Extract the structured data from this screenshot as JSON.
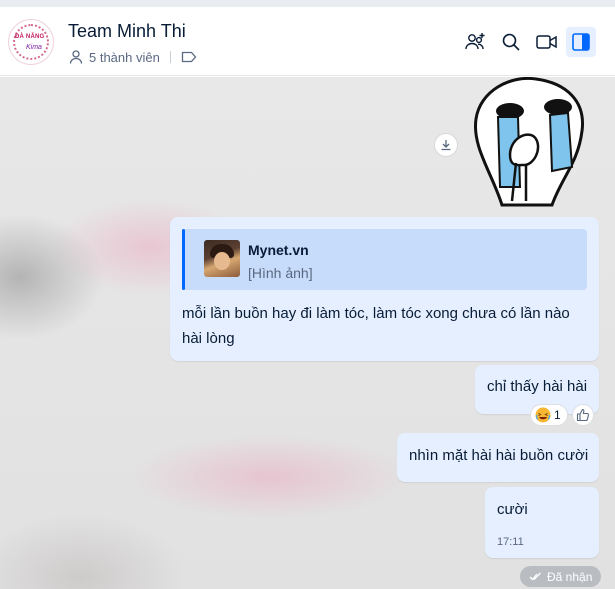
{
  "header": {
    "title": "Team Minh Thi",
    "member_count": "5 thành viên",
    "avatar_text_line1": "ĐÀ NẴNG",
    "avatar_text_line2": "Kima",
    "icons": [
      "add-member-icon",
      "search-icon",
      "video-call-icon",
      "sidebar-toggle-icon"
    ],
    "accent_color": "#0068ff"
  },
  "messages": [
    {
      "type": "sticker",
      "description_icon": "crying-sticker",
      "action": "download-icon"
    },
    {
      "type": "text",
      "quote": {
        "name": "Mynet.vn",
        "content": "[Hình ảnh]"
      },
      "text": "mỗi lần buồn hay đi làm tóc, làm tóc xong chưa có lần nào hài lòng"
    },
    {
      "type": "text",
      "text": "chỉ thấy hài hài",
      "reaction": {
        "emoji": "laughing-emoji",
        "count": "1"
      }
    },
    {
      "type": "text",
      "text": "nhìn mặt hài hài buồn cười"
    },
    {
      "type": "text",
      "text": "cười",
      "time": "17:11"
    }
  ],
  "status": {
    "label": "Đã nhận"
  }
}
